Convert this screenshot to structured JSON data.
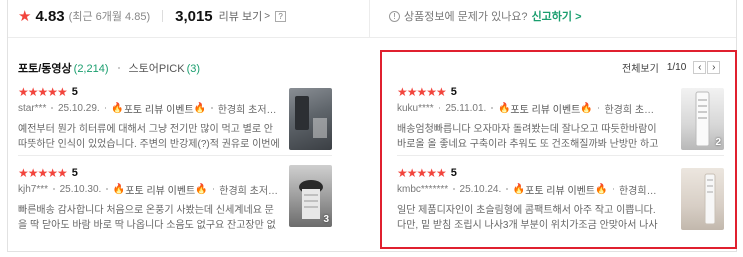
{
  "summary": {
    "rating": "4.83",
    "recent_rating": "(최근 6개월 4.85)",
    "review_count": "3,015",
    "review_count_label": "리뷰 보기",
    "chevron": ">",
    "help_mark": "?"
  },
  "report": {
    "question": "상품정보에 문제가 있나요?",
    "link": "신고하기 >"
  },
  "tabs": [
    {
      "label": "포토/동영상",
      "count": "(2,214)"
    },
    {
      "label": "스토어PICK",
      "count": "(3)"
    }
  ],
  "pager": {
    "view_all": "전체보기",
    "page": "1/10",
    "prev": "‹",
    "next": "›"
  },
  "reviews": [
    {
      "stars": "★★★★★",
      "score": "5",
      "user": "star***",
      "date": "25.10.29.",
      "fire": "🔥",
      "event": "포토 리뷰 이벤트",
      "product": "한경희 초저소음 ...",
      "text": "예전부터 뭔가 히터류에 대해서 그냥 전기만 많이 먹고 별로 안따뜻하단 인식이 있었습니다. 주변의 반강제(?)적 권유로 이번에 해당 제품을 구",
      "photo_count": ""
    },
    {
      "stars": "★★★★★",
      "score": "5",
      "user": "kjh7***",
      "date": "25.10.30.",
      "fire": "🔥",
      "event": "포토 리뷰 이벤트",
      "product": "한경희 초저소음 ...",
      "text": "빠른배송 감사합니다 처음으로 온풍기 사봤는데 신세계네요 문을 딱 닫아도 바람 바로 딱 나옵니다 소음도 없구요 잔고장만 없음 오래 쓸수있을것 같습니다",
      "photo_count": "3"
    },
    {
      "stars": "★★★★★",
      "score": "5",
      "user": "kuku****",
      "date": "25.11.01.",
      "fire": "🔥",
      "event": "포토 리뷰 이벤트",
      "product": "한경희 초저소...",
      "text": "배송엄청빠릅니다 오자마자 돌려봤는데 잘나오고 따듯한바람이 바로올 올 좋네요 구축이라 추워도 또 건조해질까봐 난방만 하고 그랬는데ㅠ 이제",
      "photo_count": "2"
    },
    {
      "stars": "★★★★★",
      "score": "5",
      "user": "kmbc*******",
      "date": "25.10.24.",
      "fire": "🔥",
      "event": "포토 리뷰 이벤트",
      "product": "한경희 초저...",
      "text": "일단 제품디자인이 초슬림형에 콤팩트해서 아주 작고 이쁩니다. 다만, 밑 받침 조립시 나사3개 부분이 위치가조금 안맞아서 나사조일때 어긋나",
      "photo_count": ""
    }
  ],
  "colors": {
    "star": "#f2453d",
    "accent_green": "#1a9e6e",
    "highlight_red": "#e0202f"
  }
}
